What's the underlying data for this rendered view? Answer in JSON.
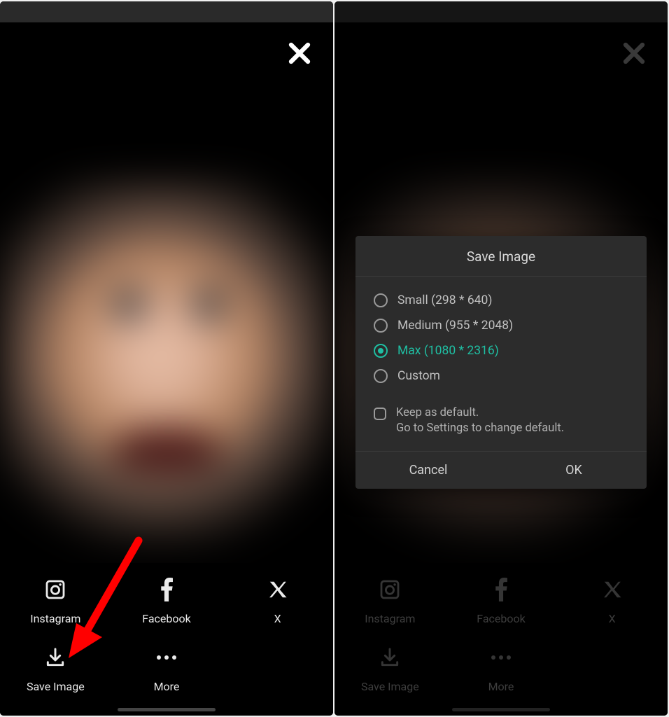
{
  "share": {
    "instagram": "Instagram",
    "facebook": "Facebook",
    "x": "X",
    "save": "Save Image",
    "more": "More"
  },
  "dialog": {
    "title": "Save Image",
    "options": [
      {
        "label": "Small (298 * 640)",
        "selected": false
      },
      {
        "label": "Medium (955 * 2048)",
        "selected": false
      },
      {
        "label": "Max (1080 * 2316)",
        "selected": true
      },
      {
        "label": "Custom",
        "selected": false
      }
    ],
    "keep_default_line1": "Keep as default.",
    "keep_default_line2": "Go to Settings to change default.",
    "cancel": "Cancel",
    "ok": "OK"
  },
  "colors": {
    "accent": "#1fbfa3",
    "arrow": "#ff0000"
  }
}
